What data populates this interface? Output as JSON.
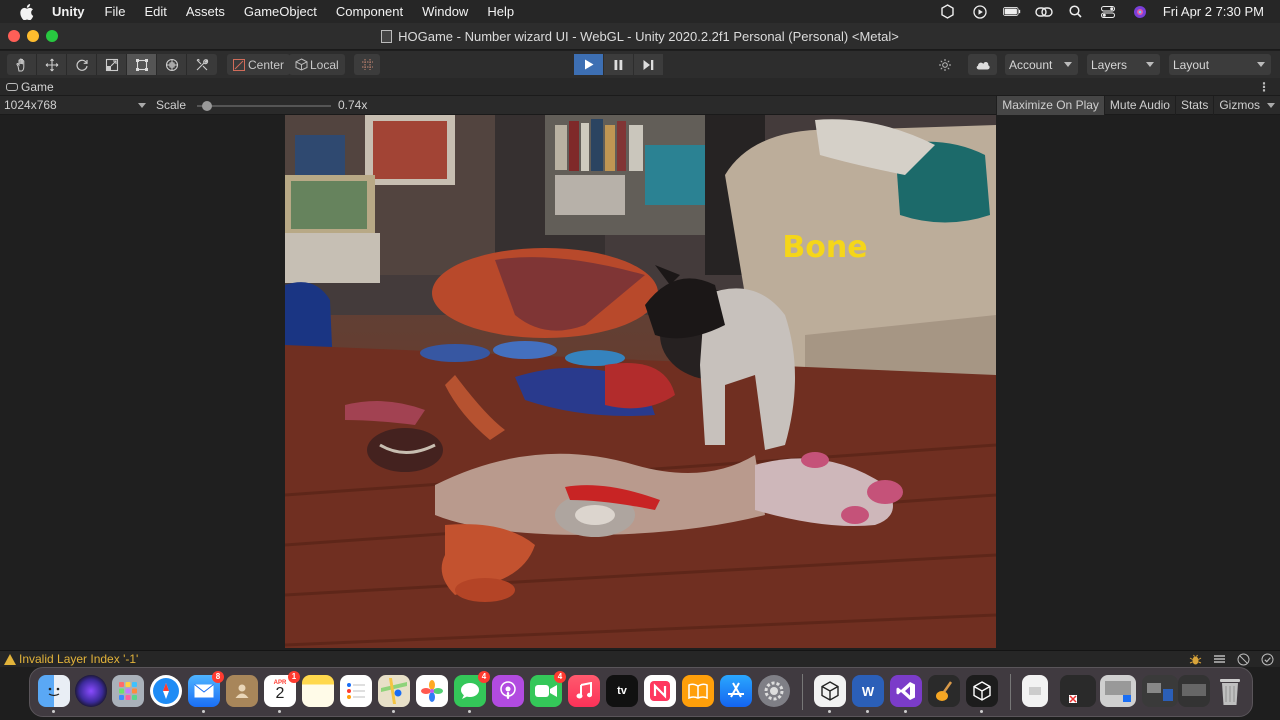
{
  "menubar": {
    "apple_icon": "apple-icon",
    "app_name": "Unity",
    "items": [
      "File",
      "Edit",
      "Assets",
      "GameObject",
      "Component",
      "Window",
      "Help"
    ],
    "clock": "Fri Apr 2  7:30 PM"
  },
  "window": {
    "title": "HOGame - Number wizard UI - WebGL - Unity 2020.2.2f1 Personal (Personal) <Metal>"
  },
  "toolbar": {
    "pivot_label": "Center",
    "rotation_label": "Local",
    "account_label": "Account",
    "layers_label": "Layers",
    "layout_label": "Layout"
  },
  "game_tab": {
    "label": "Game",
    "resolution": "1024x768",
    "scale_label": "Scale",
    "scale_value": "0.74x",
    "scale_fraction": 0.04,
    "maximize_label": "Maximize On Play",
    "mute_label": "Mute Audio",
    "stats_label": "Stats",
    "gizmos_label": "Gizmos"
  },
  "scene": {
    "hint_word": "Bone",
    "hint_color": "#f5d619"
  },
  "status": {
    "message": "Invalid Layer Index '-1'"
  },
  "dock": {
    "calendar_month": "APR",
    "calendar_day": "2",
    "mail_badge": "8",
    "calendar_badge": "1",
    "messages_badge": "4",
    "facetime_badge": "4",
    "word_letter": "W",
    "tv_label": "tv"
  }
}
